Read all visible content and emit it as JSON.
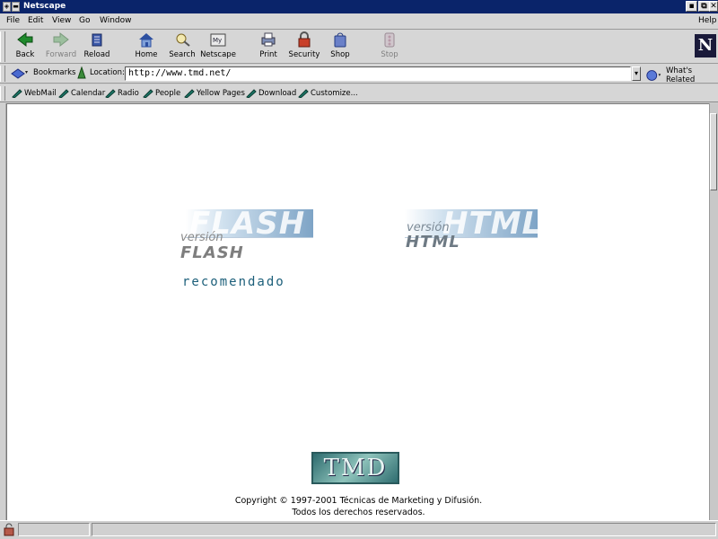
{
  "window": {
    "title": "Netscape",
    "buttons": [
      "▪",
      "⧉",
      "✕"
    ]
  },
  "menu": [
    "File",
    "Edit",
    "View",
    "Go",
    "Window",
    "Help"
  ],
  "nav": {
    "back": "Back",
    "forward": "Forward",
    "reload": "Reload",
    "home": "Home",
    "search": "Search",
    "netscape": "Netscape",
    "print": "Print",
    "security": "Security",
    "shop": "Shop",
    "stop": "Stop",
    "logo": "N"
  },
  "location": {
    "bookmarks_label": "Bookmarks",
    "location_label": "Location:",
    "url": "http://www.tmd.net/",
    "whats_related": "What's Related"
  },
  "personal": [
    "WebMail",
    "Calendar",
    "Radio",
    "People",
    "Yellow Pages",
    "Download",
    "Customize..."
  ],
  "page": {
    "flash": {
      "ghost": "FLASH",
      "small": "versión",
      "big": "FLASH"
    },
    "html": {
      "ghost": "HTML",
      "small": "versión",
      "big": "HTML"
    },
    "recommended": "recomendado",
    "logo_text": "TMD",
    "copyright_line1": "Copyright © 1997-2001 Técnicas de Marketing y Difusión.",
    "copyright_line2": "Todos los derechos reservados."
  },
  "colors": {
    "titlebar": "#0a246a",
    "chrome": "#d6d6d6",
    "recommended": "#1c5f7a",
    "banner_blue": "#7ea4c6"
  }
}
